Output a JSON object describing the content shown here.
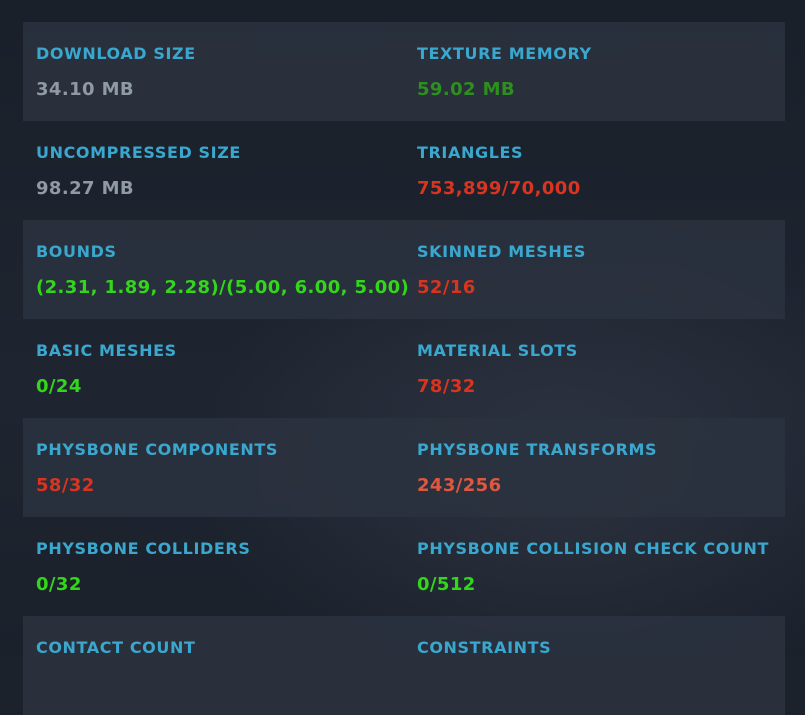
{
  "colors": {
    "label": "#3aa7cf",
    "value_gray": "#8f9aa4",
    "value_dark_green": "#2d8f1e",
    "value_green": "#33d61a",
    "value_red": "#d8341f"
  },
  "stats": [
    {
      "left": {
        "label": "DOWNLOAD SIZE",
        "value": "34.10 MB"
      },
      "right": {
        "label": "TEXTURE MEMORY",
        "value": "59.02 MB"
      }
    },
    {
      "left": {
        "label": "UNCOMPRESSED SIZE",
        "value": "98.27 MB"
      },
      "right": {
        "label": "TRIANGLES",
        "value": "753,899/70,000"
      }
    },
    {
      "left": {
        "label": "BOUNDS",
        "value": "(2.31, 1.89, 2.28)/(5.00, 6.00, 5.00)"
      },
      "right": {
        "label": "SKINNED MESHES",
        "value": "52/16"
      }
    },
    {
      "left": {
        "label": "BASIC MESHES",
        "value": "0/24"
      },
      "right": {
        "label": "MATERIAL SLOTS",
        "value": "78/32"
      }
    },
    {
      "left": {
        "label": "PHYSBONE COMPONENTS",
        "value": "58/32"
      },
      "right": {
        "label": "PHYSBONE TRANSFORMS",
        "value": "243/256"
      }
    },
    {
      "left": {
        "label": "PHYSBONE COLLIDERS",
        "value": "0/32"
      },
      "right": {
        "label": "PHYSBONE COLLISION CHECK COUNT",
        "value": "0/512"
      }
    },
    {
      "left": {
        "label": "CONTACT COUNT",
        "value": ""
      },
      "right": {
        "label": "CONSTRAINTS",
        "value": ""
      }
    }
  ]
}
